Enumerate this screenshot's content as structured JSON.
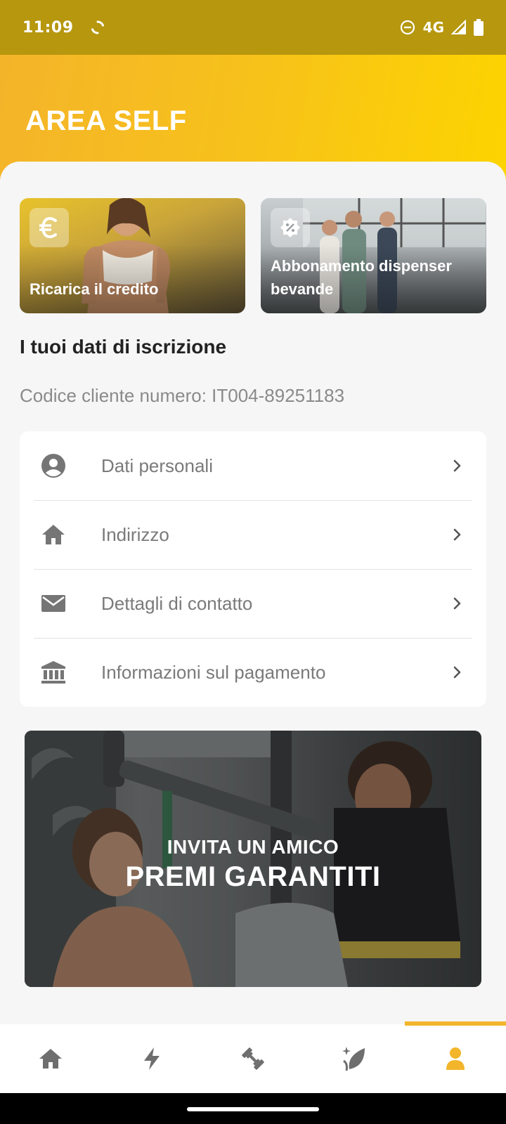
{
  "status_bar": {
    "time": "11:09",
    "network": "4G"
  },
  "header": {
    "title": "AREA SELF"
  },
  "promo_cards": [
    {
      "label": "Ricarica il credito",
      "icon": "euro-icon"
    },
    {
      "label": "Abbonamento dispenser bevande",
      "icon": "discount-badge-icon"
    }
  ],
  "registration": {
    "section_title": "I tuoi dati di iscrizione",
    "client_code": "Codice cliente numero: IT004-89251183",
    "menu": [
      {
        "label": "Dati personali",
        "icon": "person-circle-icon"
      },
      {
        "label": "Indirizzo",
        "icon": "home-icon"
      },
      {
        "label": "Dettagli di contatto",
        "icon": "mail-icon"
      },
      {
        "label": "Informazioni sul pagamento",
        "icon": "bank-icon"
      }
    ]
  },
  "banner": {
    "subtitle": "INVITA UN AMICO",
    "title": "PREMI GARANTITI"
  },
  "bottom_nav": {
    "items": [
      "home-icon",
      "lightning-icon",
      "dumbbell-icon",
      "sparkle-leaf-icon",
      "profile-icon"
    ],
    "active": "profile-icon"
  },
  "colors": {
    "accent": "#f2b52b",
    "header_start": "#f4b42a",
    "header_end": "#fdd400",
    "status_bar": "#b6970e"
  }
}
